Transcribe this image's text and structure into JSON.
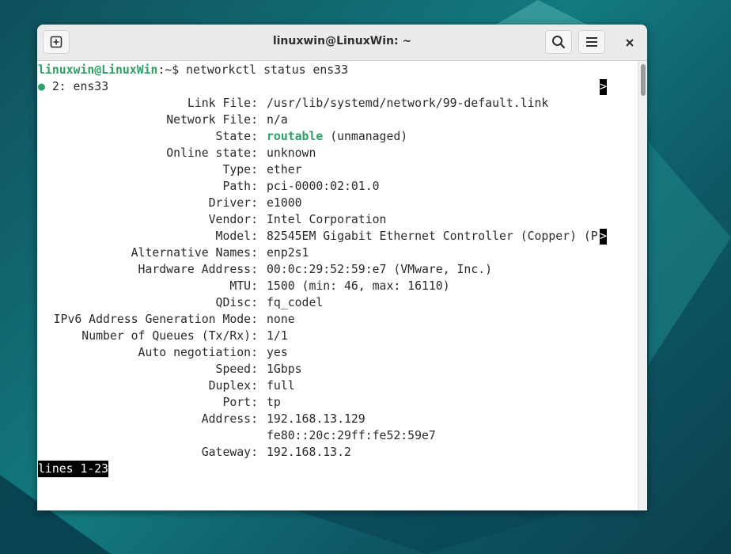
{
  "window": {
    "title": "linuxwin@LinuxWin: ~"
  },
  "icons": {
    "new_tab": "new-tab-icon",
    "search": "search-icon",
    "menu": "hamburger-menu-icon",
    "close": "close-icon"
  },
  "colors": {
    "prompt_green": "#2f9e67",
    "terminal_bg": "#ffffff"
  },
  "terminal": {
    "prompt_user": "linuxwin@LinuxWin",
    "prompt_path": ":~$ ",
    "command": "networkctl status ens33",
    "link_dot": "●",
    "link_header": " 2: ens33",
    "overflow_marker": ">",
    "rows": [
      {
        "key": "Link File:",
        "value": "/usr/lib/systemd/network/99-default.link"
      },
      {
        "key": "Network File:",
        "value": "n/a"
      },
      {
        "key": "State:",
        "value": "routable",
        "suffix": " (unmanaged)"
      },
      {
        "key": "Online state:",
        "value": "unknown"
      },
      {
        "key": "Type:",
        "value": "ether"
      },
      {
        "key": "Path:",
        "value": "pci-0000:02:01.0"
      },
      {
        "key": "Driver:",
        "value": "e1000"
      },
      {
        "key": "Vendor:",
        "value": "Intel Corporation"
      },
      {
        "key": "Model:",
        "value": "82545EM Gigabit Ethernet Controller (Copper) (P"
      },
      {
        "key": "Alternative Names:",
        "value": "enp2s1"
      },
      {
        "key": "Hardware Address:",
        "value": "00:0c:29:52:59:e7 (VMware, Inc.)"
      },
      {
        "key": "MTU:",
        "value": "1500 (min: 46, max: 16110)"
      },
      {
        "key": "QDisc:",
        "value": "fq_codel"
      },
      {
        "key": "IPv6 Address Generation Mode:",
        "value": "none"
      },
      {
        "key": "Number of Queues (Tx/Rx):",
        "value": "1/1"
      },
      {
        "key": "Auto negotiation:",
        "value": "yes"
      },
      {
        "key": "Speed:",
        "value": "1Gbps"
      },
      {
        "key": "Duplex:",
        "value": "full"
      },
      {
        "key": "Port:",
        "value": "tp"
      },
      {
        "key": "Address:",
        "value": "192.168.13.129"
      },
      {
        "key": "",
        "value": "fe80::20c:29ff:fe52:59e7"
      },
      {
        "key": "Gateway:",
        "value": "192.168.13.2"
      }
    ],
    "pager_status": "lines 1-23"
  }
}
